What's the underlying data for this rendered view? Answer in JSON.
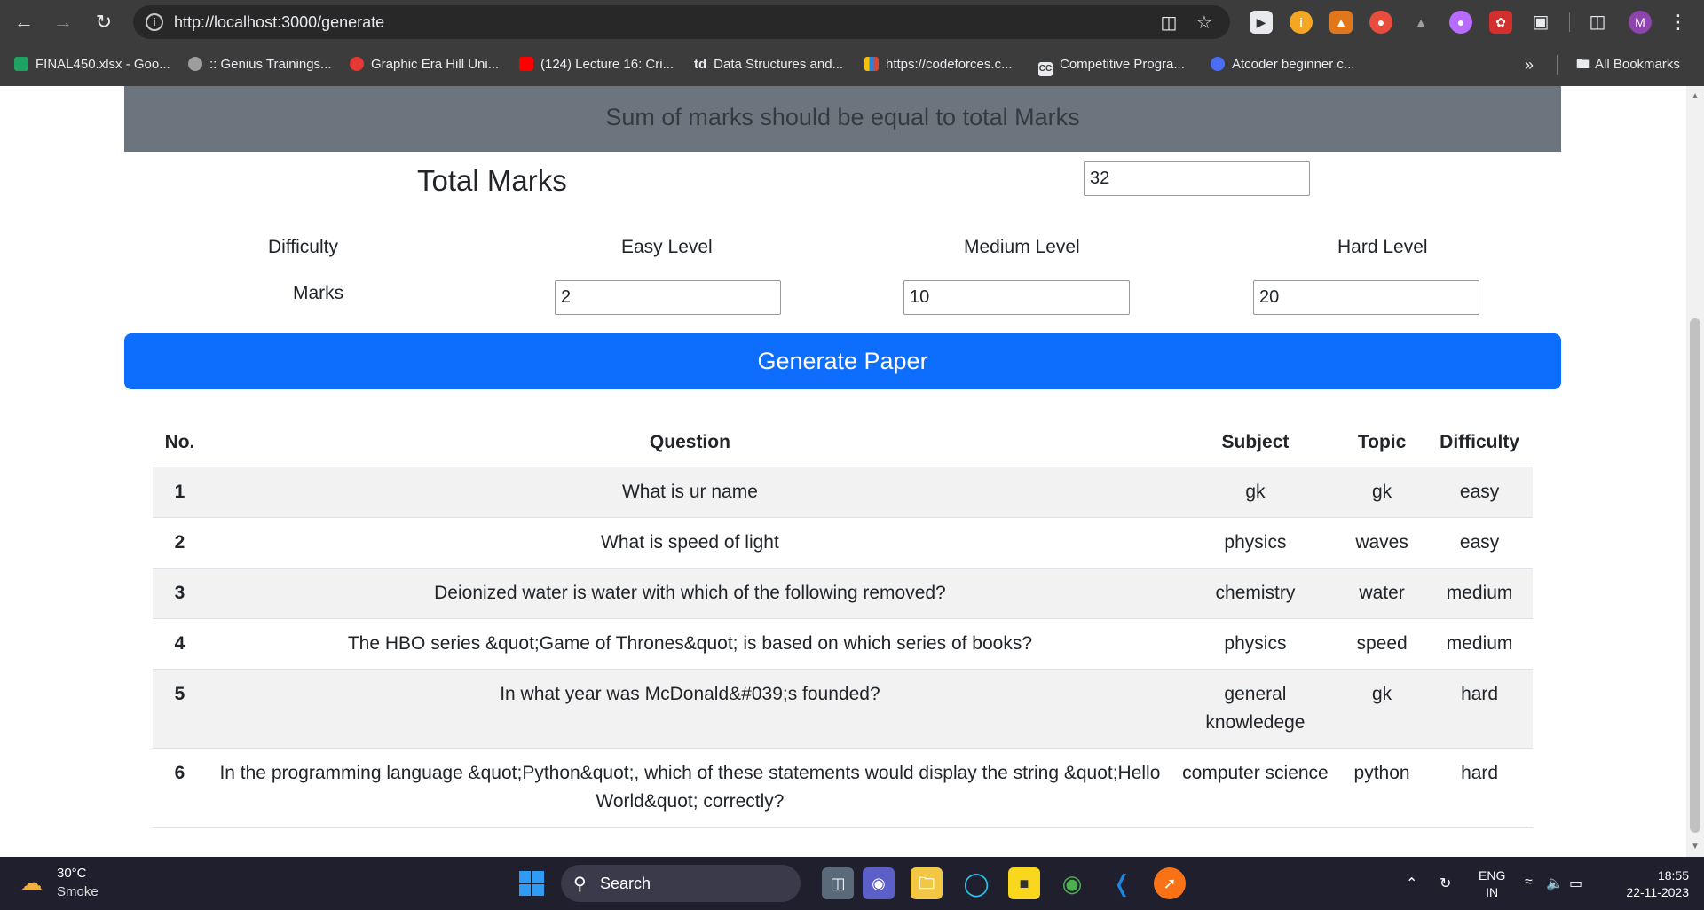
{
  "browser": {
    "url": "http://localhost:3000/generate",
    "bookmarks": [
      {
        "label": "FINAL450.xlsx - Goo...",
        "color": "#1ea362"
      },
      {
        "label": ":: Genius Trainings...",
        "color": "#9e9e9e"
      },
      {
        "label": "Graphic Era Hill Uni...",
        "color": "#e53935"
      },
      {
        "label": "(124) Lecture 16: Cri...",
        "color": "#ff0000"
      },
      {
        "label": "Data Structures and...",
        "color": "#3c3c3c",
        "glyph": "td"
      },
      {
        "label": "https://codeforces.c...",
        "color": "#1e88e5"
      },
      {
        "label": "Competitive Progra...",
        "color": "#5d4037",
        "glyph": "CC"
      },
      {
        "label": "Atcoder beginner c...",
        "color": "#4c6ef5"
      }
    ],
    "all_bookmarks": "All Bookmarks",
    "profile_initial": "M"
  },
  "page": {
    "alert": "Sum of marks should be equal to total Marks",
    "total_label": "Total Marks",
    "total_value": "32",
    "difficulty_label": "Difficulty",
    "marks_label": "Marks",
    "levels": [
      {
        "label": "Easy Level",
        "value": "2"
      },
      {
        "label": "Medium Level",
        "value": "10"
      },
      {
        "label": "Hard Level",
        "value": "20"
      }
    ],
    "generate_button": "Generate Paper"
  },
  "table": {
    "headers": {
      "no": "No.",
      "question": "Question",
      "subject": "Subject",
      "topic": "Topic",
      "difficulty": "Difficulty"
    },
    "rows": [
      {
        "no": "1",
        "question": "What is ur name",
        "subject": "gk",
        "topic": "gk",
        "difficulty": "easy"
      },
      {
        "no": "2",
        "question": "What is speed of light",
        "subject": "physics",
        "topic": "waves",
        "difficulty": "easy"
      },
      {
        "no": "3",
        "question": "Deionized water is water with which of the following removed?",
        "subject": "chemistry",
        "topic": "water",
        "difficulty": "medium"
      },
      {
        "no": "4",
        "question": "The HBO series &quot;Game of Thrones&quot; is based on which series of books?",
        "subject": "physics",
        "topic": "speed",
        "difficulty": "medium"
      },
      {
        "no": "5",
        "question": "In what year was McDonald&#039;s founded?",
        "subject": "general knowledege",
        "topic": "gk",
        "difficulty": "hard"
      },
      {
        "no": "6",
        "question": "In the programming language &quot;Python&quot;, which of these statements would display the string &quot;Hello World&quot; correctly?",
        "subject": "computer science",
        "topic": "python",
        "difficulty": "hard"
      }
    ]
  },
  "taskbar": {
    "temperature": "30°C",
    "weather": "Smoke",
    "search": "Search",
    "lang_line1": "ENG",
    "lang_line2": "IN",
    "time": "18:55",
    "date": "22-11-2023"
  }
}
